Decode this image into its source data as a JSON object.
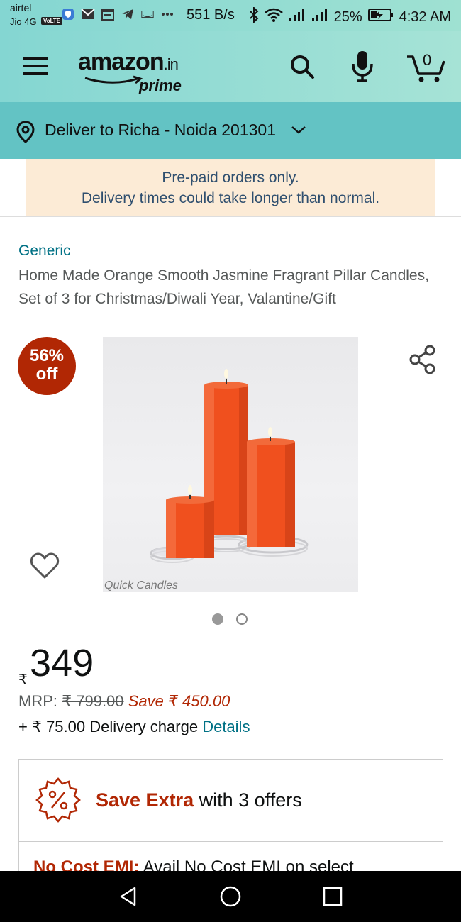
{
  "status_bar": {
    "carrier1": "airtel",
    "carrier2": "Jio 4G",
    "volte": "VoLTE",
    "network_speed": "551 B/s",
    "battery": "25%",
    "time": "4:32 AM"
  },
  "header": {
    "logo_text": "amazon",
    "logo_suffix": ".in",
    "logo_sub": "prime",
    "cart_count": "0"
  },
  "deliver": {
    "label": "Deliver to Richa - Noida 201301"
  },
  "notice": {
    "line1": "Pre-paid orders only.",
    "line2": "Delivery times could take longer than normal."
  },
  "product": {
    "brand": "Generic",
    "title": "Home Made Orange Smooth Jasmine Fragrant Pillar Candles, Set of 3 for Christmas/Diwali Year, Valantine/Gift",
    "discount_line1": "56%",
    "discount_line2": "off",
    "image_watermark": "Quick Candles",
    "currency_symbol": "₹",
    "price": "349",
    "mrp_label": "MRP:",
    "mrp_value": "₹ 799.00",
    "save_text": "Save ₹ 450.00",
    "delivery_text": "+ ₹ 75.00 Delivery charge",
    "delivery_link": "Details"
  },
  "offers": {
    "highlight": "Save Extra",
    "rest": "with 3 offers",
    "emi_highlight": "No Cost EMI:",
    "emi_rest": "Avail No Cost EMI on select"
  },
  "colors": {
    "header_bg": "#84d6d2",
    "deliver_bg": "#63c3c4",
    "badge": "#b12704",
    "link": "#007185",
    "notice_bg": "#fcebd6"
  }
}
